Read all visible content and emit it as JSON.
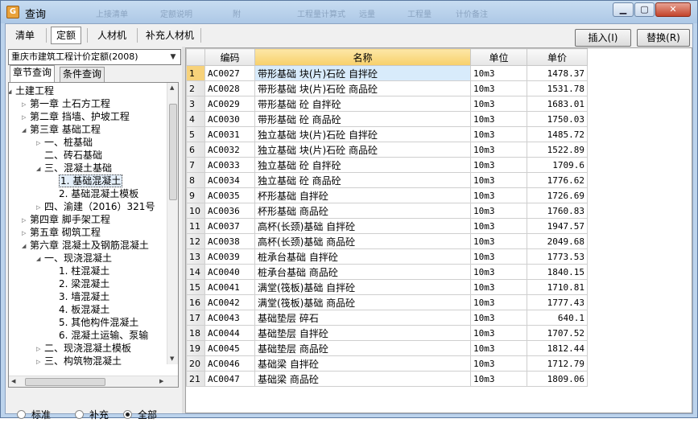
{
  "window": {
    "title": "查询"
  },
  "titlebar_ghost": [
    "上接清单",
    "定额说明",
    "附",
    "工程量计算式",
    "远量",
    "工程量",
    "计价备注"
  ],
  "tabs": [
    "清单",
    "定额",
    "人材机",
    "补充人材机"
  ],
  "active_tab": 1,
  "buttons": {
    "insert": "插入(I)",
    "replace": "替换(R)"
  },
  "quota_library": "重庆市建筑工程计价定额(2008)",
  "subtabs": [
    "章节查询",
    "条件查询"
  ],
  "tree": [
    {
      "label": "土建工程",
      "level": 0,
      "state": "open"
    },
    {
      "label": "第一章 土石方工程",
      "level": 1,
      "state": "closed"
    },
    {
      "label": "第二章 挡墙、护坡工程",
      "level": 1,
      "state": "closed"
    },
    {
      "label": "第三章 基础工程",
      "level": 1,
      "state": "open"
    },
    {
      "label": "一、桩基础",
      "level": 2,
      "state": "closed"
    },
    {
      "label": "二、砖石基础",
      "level": 2,
      "state": "leaf"
    },
    {
      "label": "三、混凝土基础",
      "level": 2,
      "state": "open"
    },
    {
      "label": "1. 基础混凝土",
      "level": 3,
      "state": "leaf",
      "selected": true
    },
    {
      "label": "2. 基础混凝土模板",
      "level": 3,
      "state": "leaf"
    },
    {
      "label": "四、渝建（2016）321号",
      "level": 2,
      "state": "closed"
    },
    {
      "label": "第四章 脚手架工程",
      "level": 1,
      "state": "closed"
    },
    {
      "label": "第五章 砌筑工程",
      "level": 1,
      "state": "closed"
    },
    {
      "label": "第六章 混凝土及钢筋混凝土",
      "level": 1,
      "state": "open"
    },
    {
      "label": "一、现浇混凝土",
      "level": 2,
      "state": "open"
    },
    {
      "label": "1. 柱混凝土",
      "level": 3,
      "state": "leaf"
    },
    {
      "label": "2. 梁混凝土",
      "level": 3,
      "state": "leaf"
    },
    {
      "label": "3. 墙混凝土",
      "level": 3,
      "state": "leaf"
    },
    {
      "label": "4. 板混凝土",
      "level": 3,
      "state": "leaf"
    },
    {
      "label": "5. 其他构件混凝土",
      "level": 3,
      "state": "leaf"
    },
    {
      "label": "6. 混凝土运输、泵输",
      "level": 3,
      "state": "leaf"
    },
    {
      "label": "二、现浇混凝土模板",
      "level": 2,
      "state": "closed"
    },
    {
      "label": "三、构筑物混凝土",
      "level": 2,
      "state": "closed"
    }
  ],
  "filter": {
    "options": [
      "标准",
      "补充",
      "全部"
    ],
    "selected": 2
  },
  "grid": {
    "headers": [
      "",
      "编码",
      "名称",
      "单位",
      "单价"
    ],
    "rows": [
      [
        "1",
        "AC0027",
        "带形基础 块(片)石砼 自拌砼",
        "10m3",
        "1478.37"
      ],
      [
        "2",
        "AC0028",
        "带形基础 块(片)石砼 商品砼",
        "10m3",
        "1531.78"
      ],
      [
        "3",
        "AC0029",
        "带形基础 砼 自拌砼",
        "10m3",
        "1683.01"
      ],
      [
        "4",
        "AC0030",
        "带形基础 砼 商品砼",
        "10m3",
        "1750.03"
      ],
      [
        "5",
        "AC0031",
        "独立基础 块(片)石砼 自拌砼",
        "10m3",
        "1485.72"
      ],
      [
        "6",
        "AC0032",
        "独立基础 块(片)石砼 商品砼",
        "10m3",
        "1522.89"
      ],
      [
        "7",
        "AC0033",
        "独立基础 砼 自拌砼",
        "10m3",
        "1709.6"
      ],
      [
        "8",
        "AC0034",
        "独立基础 砼 商品砼",
        "10m3",
        "1776.62"
      ],
      [
        "9",
        "AC0035",
        "杯形基础 自拌砼",
        "10m3",
        "1726.69"
      ],
      [
        "10",
        "AC0036",
        "杯形基础 商品砼",
        "10m3",
        "1760.83"
      ],
      [
        "11",
        "AC0037",
        "高杯(长颈)基础 自拌砼",
        "10m3",
        "1947.57"
      ],
      [
        "12",
        "AC0038",
        "高杯(长颈)基础 商品砼",
        "10m3",
        "2049.68"
      ],
      [
        "13",
        "AC0039",
        "桩承台基础 自拌砼",
        "10m3",
        "1773.53"
      ],
      [
        "14",
        "AC0040",
        "桩承台基础 商品砼",
        "10m3",
        "1840.15"
      ],
      [
        "15",
        "AC0041",
        "满堂(筏板)基础 自拌砼",
        "10m3",
        "1710.81"
      ],
      [
        "16",
        "AC0042",
        "满堂(筏板)基础 商品砼",
        "10m3",
        "1777.43"
      ],
      [
        "17",
        "AC0043",
        "基础垫层 碎石",
        "10m3",
        "640.1"
      ],
      [
        "18",
        "AC0044",
        "基础垫层 自拌砼",
        "10m3",
        "1707.52"
      ],
      [
        "19",
        "AC0045",
        "基础垫层 商品砼",
        "10m3",
        "1812.44"
      ],
      [
        "20",
        "AC0046",
        "基础梁 自拌砼",
        "10m3",
        "1712.79"
      ],
      [
        "21",
        "AC0047",
        "基础梁 商品砼",
        "10m3",
        "1809.06"
      ]
    ],
    "selected_row": 0
  }
}
